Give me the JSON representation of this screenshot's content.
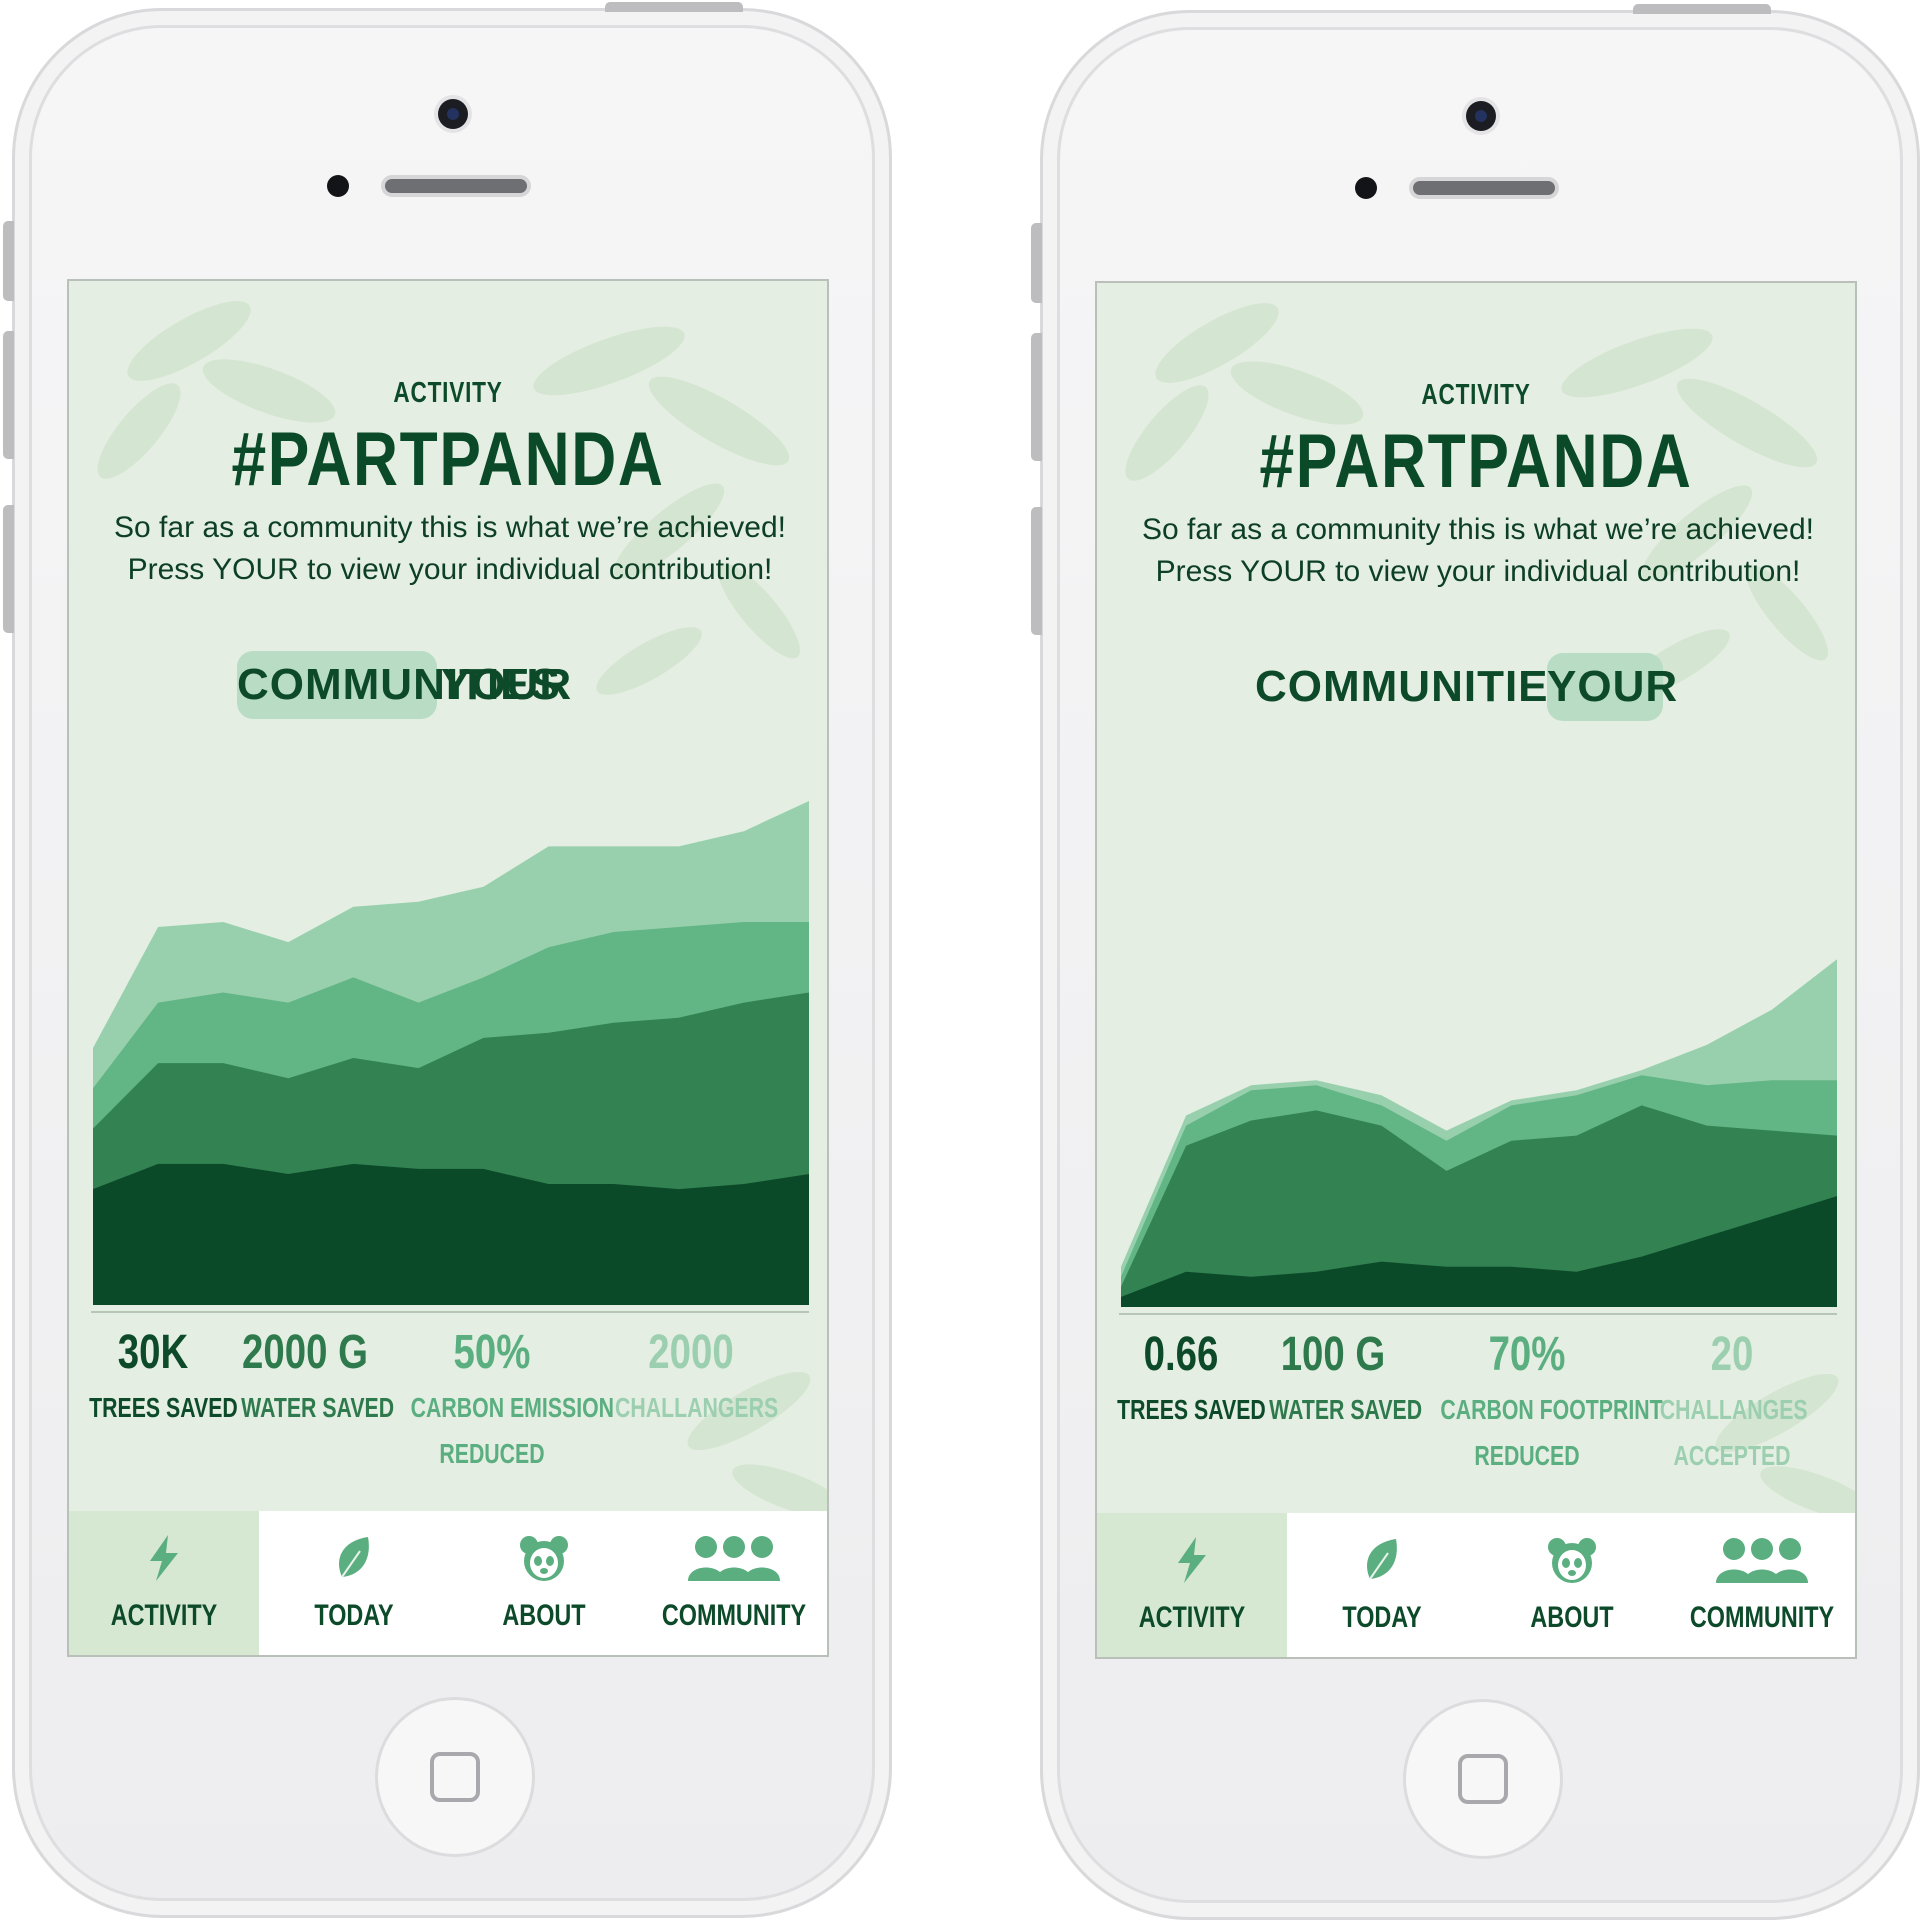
{
  "screens": [
    {
      "header": {
        "section": "ACTIVITY",
        "title": "#PARTPANDA",
        "subtitle_line1": "So far as a community this is what we’re achieved!",
        "subtitle_line2": "Press YOUR to view your individual contribution!"
      },
      "tabs": [
        {
          "label": "COMMUNITIES",
          "active": true
        },
        {
          "label": "YOUR",
          "active": false
        }
      ],
      "stats": [
        {
          "value": "30K",
          "label1": "TREES SAVED",
          "label2": "",
          "color": "#0d4a2a"
        },
        {
          "value": "2000 G",
          "label1": "WATER SAVED",
          "label2": "",
          "color": "#2f7a4d"
        },
        {
          "value": "50%",
          "label1": "CARBON EMISSION",
          "label2": "REDUCED",
          "color": "#5aae7f"
        },
        {
          "value": "2000",
          "label1": "CHALLANGERS",
          "label2": "",
          "color": "#9bcfb0"
        }
      ],
      "nav": [
        {
          "label": "ACTIVITY",
          "icon": "lightning-icon",
          "active": true
        },
        {
          "label": "TODAY",
          "icon": "leaf-icon",
          "active": false
        },
        {
          "label": "ABOUT",
          "icon": "panda-icon",
          "active": false
        },
        {
          "label": "COMMUNITY",
          "icon": "people-icon",
          "active": false
        }
      ],
      "chart_data": {
        "type": "area",
        "stacked": true,
        "x": [
          0,
          1,
          2,
          3,
          4,
          5,
          6,
          7,
          8,
          9,
          10,
          11
        ],
        "ylim": [
          0,
          100
        ],
        "grid": false,
        "legend": "none",
        "series": [
          {
            "color": "#0b4a29",
            "values": [
              23,
              28,
              28,
              26,
              28,
              27,
              27,
              24,
              24,
              23,
              24,
              26
            ]
          },
          {
            "color": "#338352",
            "values": [
              12,
              20,
              20,
              19,
              21,
              20,
              26,
              30,
              32,
              34,
              36,
              36
            ]
          },
          {
            "color": "#62b584",
            "values": [
              8,
              12,
              14,
              15,
              16,
              13,
              12,
              17,
              18,
              18,
              16,
              14
            ]
          },
          {
            "color": "#98d0ae",
            "values": [
              8,
              15,
              14,
              12,
              14,
              20,
              18,
              20,
              17,
              16,
              18,
              24
            ]
          }
        ]
      }
    },
    {
      "header": {
        "section": "ACTIVITY",
        "title": "#PARTPANDA",
        "subtitle_line1": "So far as a community this is what we’re achieved!",
        "subtitle_line2": "Press YOUR to view your individual contribution!"
      },
      "tabs": [
        {
          "label": "COMMUNITIES",
          "active": false
        },
        {
          "label": "YOUR",
          "active": true
        }
      ],
      "stats": [
        {
          "value": "0.66",
          "label1": "TREES SAVED",
          "label2": "",
          "color": "#0d4a2a"
        },
        {
          "value": "100 G",
          "label1": "WATER SAVED",
          "label2": "",
          "color": "#2f7a4d"
        },
        {
          "value": "70%",
          "label1": "CARBON FOOTPRINT",
          "label2": "REDUCED",
          "color": "#5aae7f"
        },
        {
          "value": "20",
          "label1": "CHALLANGES",
          "label2": "ACCEPTED",
          "color": "#9bcfb0"
        }
      ],
      "nav": [
        {
          "label": "ACTIVITY",
          "icon": "lightning-icon",
          "active": true
        },
        {
          "label": "TODAY",
          "icon": "leaf-icon",
          "active": false
        },
        {
          "label": "ABOUT",
          "icon": "panda-icon",
          "active": false
        },
        {
          "label": "COMMUNITY",
          "icon": "people-icon",
          "active": false
        }
      ],
      "chart_data": {
        "type": "area",
        "stacked": true,
        "x": [
          0,
          1,
          2,
          3,
          4,
          5,
          6,
          7,
          8,
          9,
          10,
          11
        ],
        "ylim": [
          0,
          100
        ],
        "grid": false,
        "legend": "none",
        "series": [
          {
            "color": "#0b4a29",
            "values": [
              2,
              7,
              6,
              7,
              9,
              8,
              8,
              7,
              10,
              14,
              18,
              22
            ]
          },
          {
            "color": "#338352",
            "values": [
              2,
              25,
              31,
              32,
              27,
              19,
              25,
              27,
              30,
              22,
              17,
              12
            ]
          },
          {
            "color": "#62b584",
            "values": [
              2,
              4,
              6,
              5,
              4,
              6,
              7,
              8,
              6,
              8,
              10,
              11
            ]
          },
          {
            "color": "#98d0ae",
            "values": [
              2,
              2,
              1,
              1,
              2,
              2,
              1,
              1,
              1,
              8,
              14,
              24
            ]
          }
        ]
      }
    }
  ]
}
